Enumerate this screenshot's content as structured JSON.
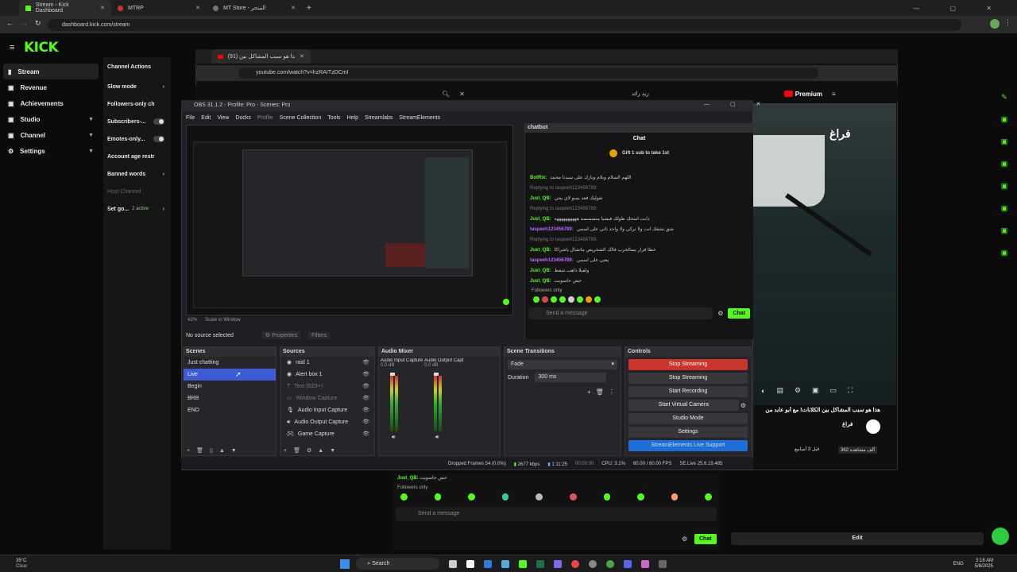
{
  "browser": {
    "tabs": [
      {
        "label": "Stream - Kick Dashboard",
        "active": true
      },
      {
        "label": "MTRP",
        "active": false
      },
      {
        "label": "MT Store - المتجر",
        "active": false
      }
    ],
    "url": "dashboard.kick.com/stream"
  },
  "kick": {
    "logo": "KICK",
    "sidebar": [
      {
        "label": "Stream",
        "active": true
      },
      {
        "label": "Revenue"
      },
      {
        "label": "Achievements"
      },
      {
        "label": "Studio"
      },
      {
        "label": "Channel"
      },
      {
        "label": "Settings"
      }
    ],
    "channel_actions": {
      "title": "Channel Actions",
      "items": [
        {
          "label": "Slow mode"
        },
        {
          "label": "Followers-only ch"
        },
        {
          "label": "Subscribers-..."
        },
        {
          "label": "Emotes-only..."
        },
        {
          "label": "Account age restr"
        },
        {
          "label": "Banned words"
        },
        {
          "label": "Host Channel"
        },
        {
          "label": "Set go...",
          "status": "2 active"
        }
      ]
    },
    "bottom_chat": {
      "last_message_user": "Just_QB:",
      "last_message_text": "خش حاسوبت",
      "followers_only": "Followers only",
      "placeholder": "Send a message",
      "chat_button": "Chat"
    },
    "edit_button": "Edit"
  },
  "youtube": {
    "tab_title": "هذا هو سبب المشاكل بين (91)",
    "url": "youtube.com/watch?v=hzRAITzDCmI",
    "search_text": "زيد رائد",
    "premium": "Premium",
    "video_title": "هذا هو سبب المشاكل بين الكلانات! مع أبو عابد من",
    "channel": "فراغ",
    "views": "362 ألف مشاهدة",
    "time": "قبل 3 أسابيع",
    "overlay_text": "فراغ"
  },
  "obs": {
    "title": "OBS 31.1.2 - Profile: Pro - Scenes: Pro",
    "menu": [
      "File",
      "Edit",
      "View",
      "Docks",
      "Profile",
      "Scene Collection",
      "Tools",
      "Help",
      "Streamlabs",
      "StreamElements"
    ],
    "no_source": "No source selected",
    "properties": "Properties",
    "filters": "Filters",
    "scenes_title": "Scenes",
    "scenes": [
      "Just chatting",
      "Live",
      "Begin",
      "BRB",
      "END"
    ],
    "selected_scene": "Live",
    "sources_title": "Sources",
    "sources": [
      "raid 1",
      "Alert box 1",
      "Text (GDI+)",
      "Window Capture",
      "Audio Input Capture",
      "Audio Output Capture",
      "Game Capture"
    ],
    "mixer_title": "Audio Mixer",
    "mixer_channels": [
      "Audio Input Capture",
      "Audio Output Capt"
    ],
    "mixer_db": [
      "0.0 dB",
      "0.0 dB"
    ],
    "transitions_title": "Scene Transitions",
    "transition": "Fade",
    "duration_label": "Duration",
    "duration_value": "300 ms",
    "controls_title": "Controls",
    "controls": [
      "Stop Streaming",
      "Stop Streaming",
      "Start Recording",
      "Start Virtual Camera",
      "Studio Mode",
      "Settings",
      "StreamElements Live Support"
    ],
    "status": {
      "dropped": "Dropped Frames 54 (0.0%)",
      "kbps": "2677 kbps",
      "live_time": "1:11:25",
      "rec_time": "00:00:00",
      "cpu": "CPU: 3.1%",
      "fps": "60.00 / 60.00 FPS",
      "version": "SE.Live 25.6.19.485"
    },
    "zoom": "42%",
    "scale": "Scale to Window"
  },
  "chatbot": {
    "title": "chatbot",
    "header": "Chat",
    "gift": "Gift 1 sub to take 1st",
    "messages": [
      {
        "user": "BotRix:",
        "text": "اللهم السلام وبلام وبارك على سيدنا محمد",
        "color": "green"
      },
      {
        "user": "Replying to taspeeh123456789:",
        "text": "",
        "color": "grey"
      },
      {
        "user": "Just_QB:",
        "text": "تقوليك قعد يسو لاي يجي",
        "color": "green"
      },
      {
        "user": "Replying to taspeeh123456789:",
        "text": "",
        "color": "grey"
      },
      {
        "user": "Just_QB:",
        "text": "ذابت اسحك طولك فيشيا متشسسه ههههههههههه",
        "color": "green"
      },
      {
        "user": "taspeeh123456789:",
        "text": "شق تشقك انت ولا تركي ولا واحد ثاني على اسمي",
        "color": "purple"
      },
      {
        "user": "Replying to taspeeh123456789:",
        "text": "",
        "color": "grey"
      },
      {
        "user": "Just_QB:",
        "text": "خطا قرار يسالخرب فالك الشخريص ماتشال ياشراكا",
        "color": "green"
      },
      {
        "user": "taspeeh123456789:",
        "text": "يعني على اسمي",
        "color": "purple"
      },
      {
        "user": "Just_QB:",
        "text": "ولقيلا ذاهب شفط",
        "color": "green"
      },
      {
        "user": "Just_QB:",
        "text": "خش حاسوبت",
        "color": "green"
      }
    ],
    "followers_only": "Followers only",
    "placeholder": "Send a message",
    "chat_button": "Chat"
  },
  "taskbar": {
    "weather_temp": "35°C",
    "weather_desc": "Clear",
    "search": "Search",
    "lang": "ENG",
    "time": "3:18 AM",
    "date": "5/8/2025"
  },
  "colors": {
    "kick_green": "#53fc18",
    "obs_red": "#c9342b",
    "obs_blue": "#3c5bd6"
  }
}
